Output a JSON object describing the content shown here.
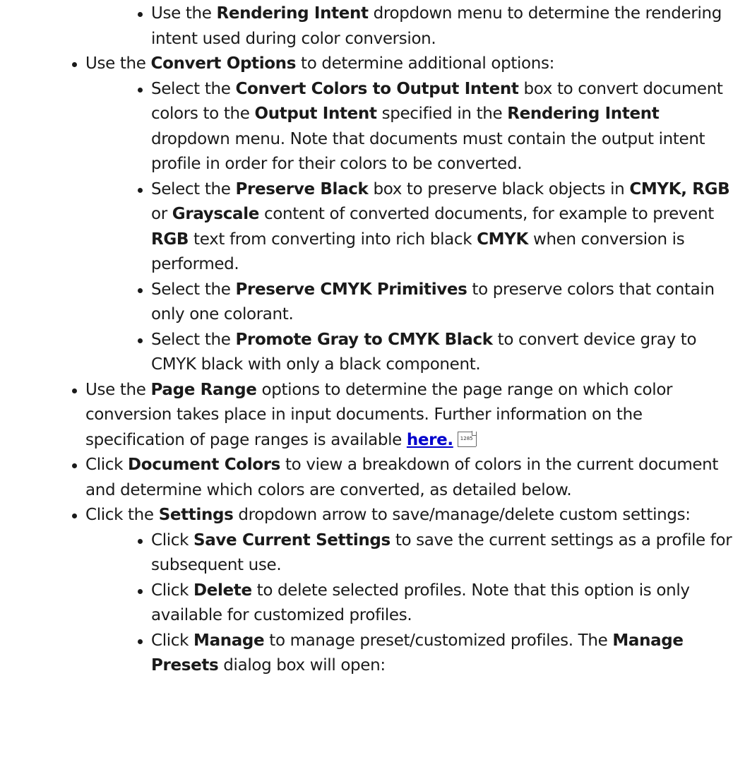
{
  "items": {
    "rendering_intent": {
      "pre": "Use the ",
      "bold": "Rendering Intent",
      "post": " dropdown menu to determine the rendering intent used during color conversion."
    },
    "convert_options": {
      "pre": "Use the ",
      "bold": "Convert Options",
      "post": " to determine additional options:"
    },
    "convert_colors": {
      "t1": "Select the ",
      "b1": "Convert Colors to Output Intent",
      "t2": " box to convert document colors to the ",
      "b2": "Output Intent",
      "t3": " specified in the ",
      "b3": "Rendering Intent",
      "t4": " dropdown menu. Note that documents must contain the output intent profile in order for their colors to be converted."
    },
    "preserve_black": {
      "t1": "Select the ",
      "b1": "Preserve Black",
      "t2": " box to preserve black objects in ",
      "b2": "CMYK, RGB",
      "t3": " or ",
      "b3": "Grayscale",
      "t4": " content of converted documents, for example to prevent ",
      "b4": "RGB",
      "t5": " text from converting into rich black ",
      "b5": "CMYK",
      "t6": " when conversion is performed."
    },
    "preserve_cmyk": {
      "pre": "Select the ",
      "bold": "Preserve CMYK Primitives",
      "post": " to preserve colors that contain only one colorant."
    },
    "promote_gray": {
      "pre": "Select the ",
      "bold": "Promote Gray to CMYK Black",
      "post": " to convert device gray to CMYK black with only a black component."
    },
    "page_range": {
      "t1": "Use the ",
      "b1": "Page Range",
      "t2": " options to determine the page range on which color conversion takes place in input documents. Further information on the specification of page ranges is available ",
      "link": "here.",
      "xref_page": "1285"
    },
    "document_colors": {
      "pre": "Click ",
      "bold": "Document Colors",
      "post": " to view a breakdown of colors in the current document and determine which colors are converted, as detailed below."
    },
    "settings": {
      "pre": "Click the ",
      "bold": "Settings",
      "post": " dropdown arrow to save/manage/delete custom settings:"
    },
    "save_current": {
      "pre": "Click ",
      "bold": "Save Current Settings",
      "post": " to save the current settings as a profile for subsequent use."
    },
    "delete": {
      "pre": "Click ",
      "bold": "Delete",
      "post": " to delete selected profiles. Note that this option is only available for customized profiles."
    },
    "manage": {
      "t1": "Click ",
      "b1": "Manage",
      "t2": " to manage preset/customized profiles. The ",
      "b2": "Manage Presets",
      "t3": " dialog box will open:"
    }
  }
}
